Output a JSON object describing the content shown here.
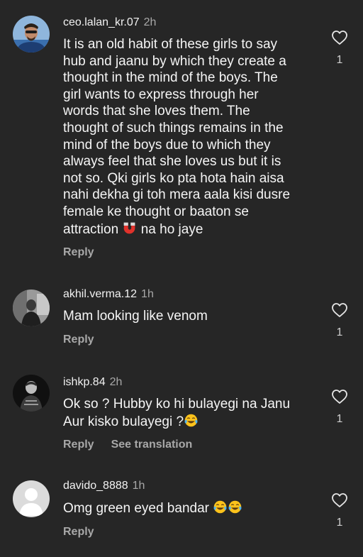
{
  "comments": [
    {
      "username": "ceo.lalan_kr.07",
      "time": "2h",
      "lines": [
        "It is an old habit of these girls to say",
        "hub and jaanu by which they create a",
        "thought in the mind of the boys. The",
        "girl wants to express through her",
        "words that she loves them. The",
        "thought of such things remains in the",
        "mind of the boys due to which they",
        "always feel that she loves us but it is",
        "not so. Qki girls ko pta hota hain aisa",
        "nahi dekha gi toh mera aala kisi dusre",
        "female ke thought or baaton se"
      ],
      "last_line_before": "attraction",
      "last_line_emoji": "magnet-emoji",
      "last_line_after": "na ho jaye",
      "reply_label": "Reply",
      "likes": "1"
    },
    {
      "username": "akhil.verma.12",
      "time": "1h",
      "text": "Mam looking like venom",
      "reply_label": "Reply",
      "likes": "1"
    },
    {
      "username": "ishkp.84",
      "time": "2h",
      "line1": "Ok so ? Hubby ko hi bulayegi na Janu",
      "line2": "Aur kisko bulayegi ?",
      "line2_emoji": "tears-of-joy-emoji",
      "reply_label": "Reply",
      "translation_label": "See translation",
      "likes": "1"
    },
    {
      "username": "davido_8888",
      "time": "1h",
      "text": "Omg green eyed bandar",
      "text_emojis": [
        "tears-of-joy-emoji",
        "tears-of-joy-emoji"
      ],
      "reply_label": "Reply",
      "likes": "1"
    }
  ],
  "colors": {
    "background": "#262626",
    "text": "#f5f5f5",
    "secondary": "#a8a8a8",
    "magnet_red": "#e0322b",
    "emoji_yellow": "#fcc21b"
  }
}
